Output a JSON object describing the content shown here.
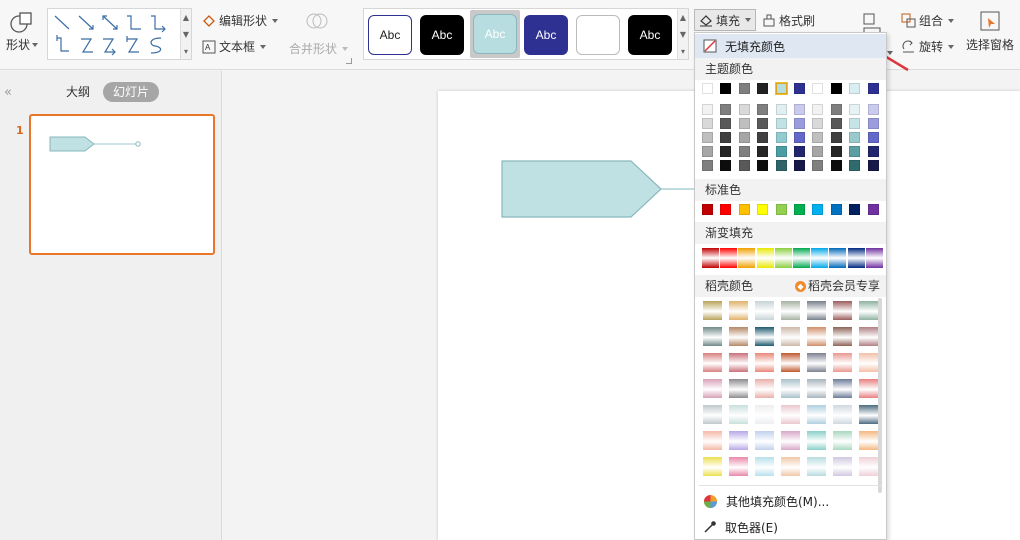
{
  "ribbon": {
    "shape_label": "形状",
    "edit_shape_label": "编辑形状",
    "textbox_label": "文本框",
    "merge_shape_label": "合并形状",
    "style_tile_text": "Abc",
    "fill_label": "填充",
    "format_painter_label": "格式刷",
    "group_label": "组合",
    "rotate_label": "旋转",
    "selection_pane_label": "选择窗格"
  },
  "left_panel": {
    "outline_tab": "大纲",
    "slides_tab": "幻灯片",
    "slide_number": "1"
  },
  "fill_menu": {
    "no_fill": "无填充颜色",
    "theme_colors_title": "主题颜色",
    "standard_colors_title": "标准色",
    "gradient_fill_title": "渐变填充",
    "docer_colors_title": "稻壳颜色",
    "docer_member_link": "稻壳会员专享",
    "more_colors": "其他填充颜色(M)...",
    "eyedropper": "取色器(E)",
    "theme_top": [
      "#ffffff",
      "#000000",
      "#7f7f7f",
      "#222222",
      "#b7dde0",
      "#2e3192",
      "#ffffff",
      "#000000",
      "#d9eef0",
      "#2e3192"
    ],
    "standard": [
      "#c00000",
      "#ff0000",
      "#ffc000",
      "#ffff00",
      "#92d050",
      "#00b050",
      "#00b0f0",
      "#0070c0",
      "#002060",
      "#7030a0"
    ],
    "gradient": [
      "#c00000",
      "#ff0000",
      "#f0a000",
      "#e8e800",
      "#8ccf40",
      "#00a850",
      "#00a8e8",
      "#0068b8",
      "#002880",
      "#7030a0"
    ]
  },
  "colors": {
    "accent_orange": "#e8762b",
    "shape_fill": "#bfe1e4",
    "shape_stroke": "#8ab8bd",
    "arrow_red": "#e0353b"
  }
}
